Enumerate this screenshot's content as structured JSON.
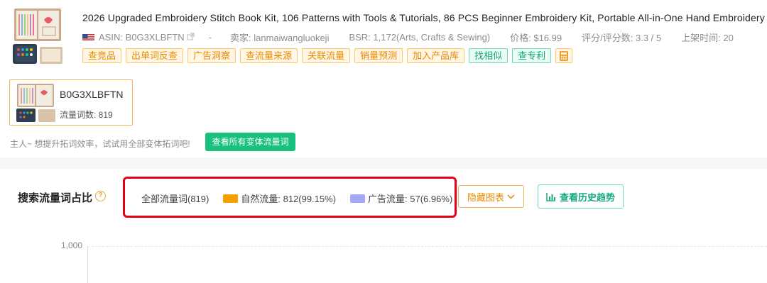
{
  "product": {
    "title": "2026 Upgraded Embroidery Stitch Book Kit, 106 Patterns with Tools & Tutorials, 86 PCS Beginner Embroidery Kit, Portable All-in-One Hand Embroidery",
    "meta": {
      "asin": "ASIN: B0G3XLBFTN",
      "dash": "-",
      "seller": "卖家: lanmaiwangluokeji",
      "bsr": "BSR: 1,172(Arts, Crafts & Sewing)",
      "price": "价格: $16.99",
      "rating": "评分/评分数: 3.3 / 5",
      "listed": "上架时间: 20"
    },
    "tags": [
      {
        "label": "查竞品",
        "style": "orange"
      },
      {
        "label": "出单词反查",
        "style": "orange"
      },
      {
        "label": "广告洞察",
        "style": "orange"
      },
      {
        "label": "查流量来源",
        "style": "orange"
      },
      {
        "label": "关联流量",
        "style": "orange"
      },
      {
        "label": "销量预测",
        "style": "orange"
      },
      {
        "label": "加入产品库",
        "style": "orange"
      },
      {
        "label": "找相似",
        "style": "teal"
      },
      {
        "label": "查专利",
        "style": "teal"
      }
    ],
    "calculator_icon": "calculator-icon"
  },
  "variant": {
    "asin": "B0G3XLBFTN",
    "count_label": "流量词数: 819"
  },
  "hint": {
    "text": "主人~ 想提升拓词效率，试试用全部变体拓词吧!",
    "button": "查看所有变体流量词"
  },
  "traffic": {
    "section_title": "搜索流量词占比",
    "legend": {
      "all": "全部流量词(819)",
      "organic": "自然流量: 812(99.15%)",
      "ads": "广告流量: 57(6.96%)"
    },
    "hide_chart": "隐藏图表",
    "history": "查看历史趋势"
  },
  "colors": {
    "organic": "#f5a000",
    "ads": "#a5a8f5",
    "highlight": "#e3001b",
    "accent_green": "#18c27c"
  },
  "chart_data": {
    "type": "bar",
    "y_ticks": [
      "1,000"
    ],
    "ylim": [
      0,
      1000
    ],
    "legend": [
      "自然流量",
      "广告流量"
    ]
  }
}
